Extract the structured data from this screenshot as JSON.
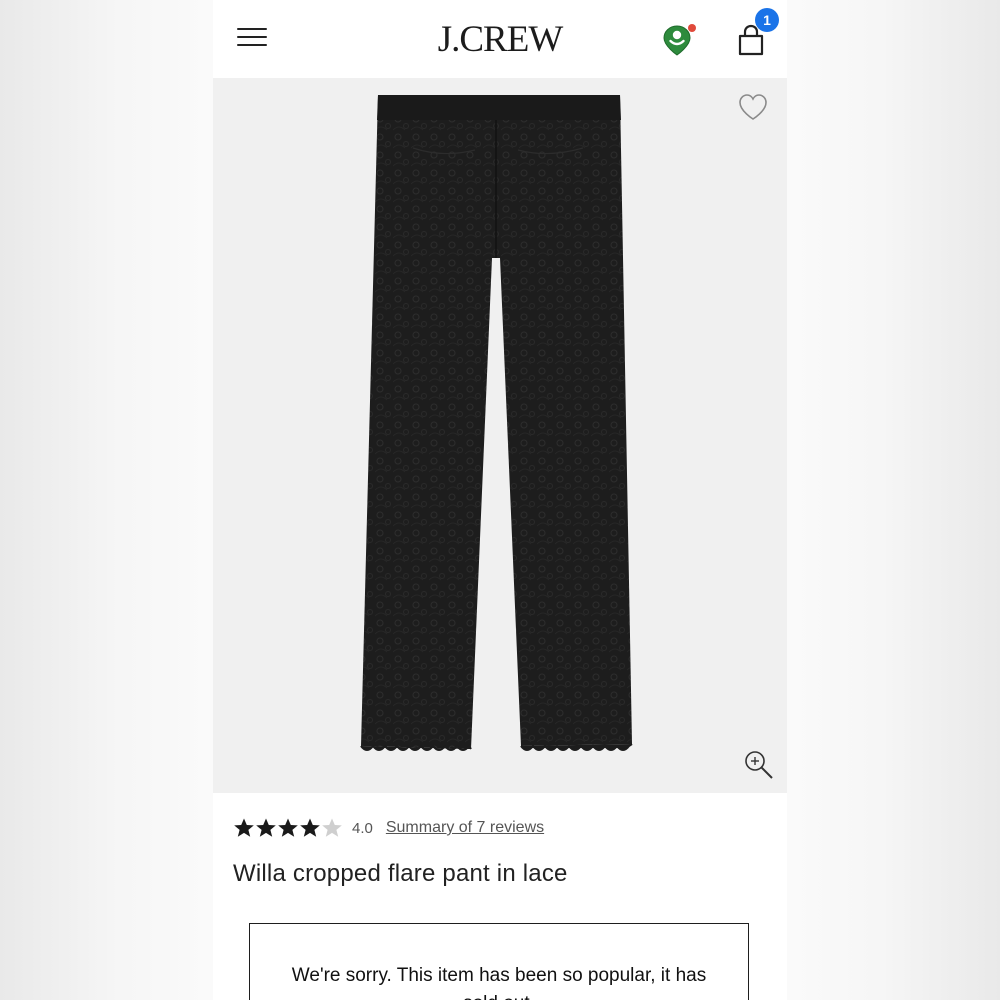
{
  "header": {
    "logo": "J.CREW",
    "cart_count": "1"
  },
  "icons": {
    "menu": "hamburger-menu-icon",
    "store": "location-pin-icon",
    "bag": "shopping-bag-icon",
    "wishlist": "heart-icon",
    "zoom": "magnify-plus-icon"
  },
  "product": {
    "rating_value": 4,
    "rating_text": "4.0",
    "reviews_link": "Summary of 7 reviews",
    "title": "Willa cropped flare pant in lace",
    "image_alt": "black lace cropped pants"
  },
  "notice": {
    "soldout_message": "We're sorry. This item has been so popular, it has sold out."
  },
  "colors": {
    "accent_badge": "#1a73e8",
    "pin_green": "#2e8b3d",
    "pin_dot": "#e04a3b",
    "text": "#222222"
  }
}
